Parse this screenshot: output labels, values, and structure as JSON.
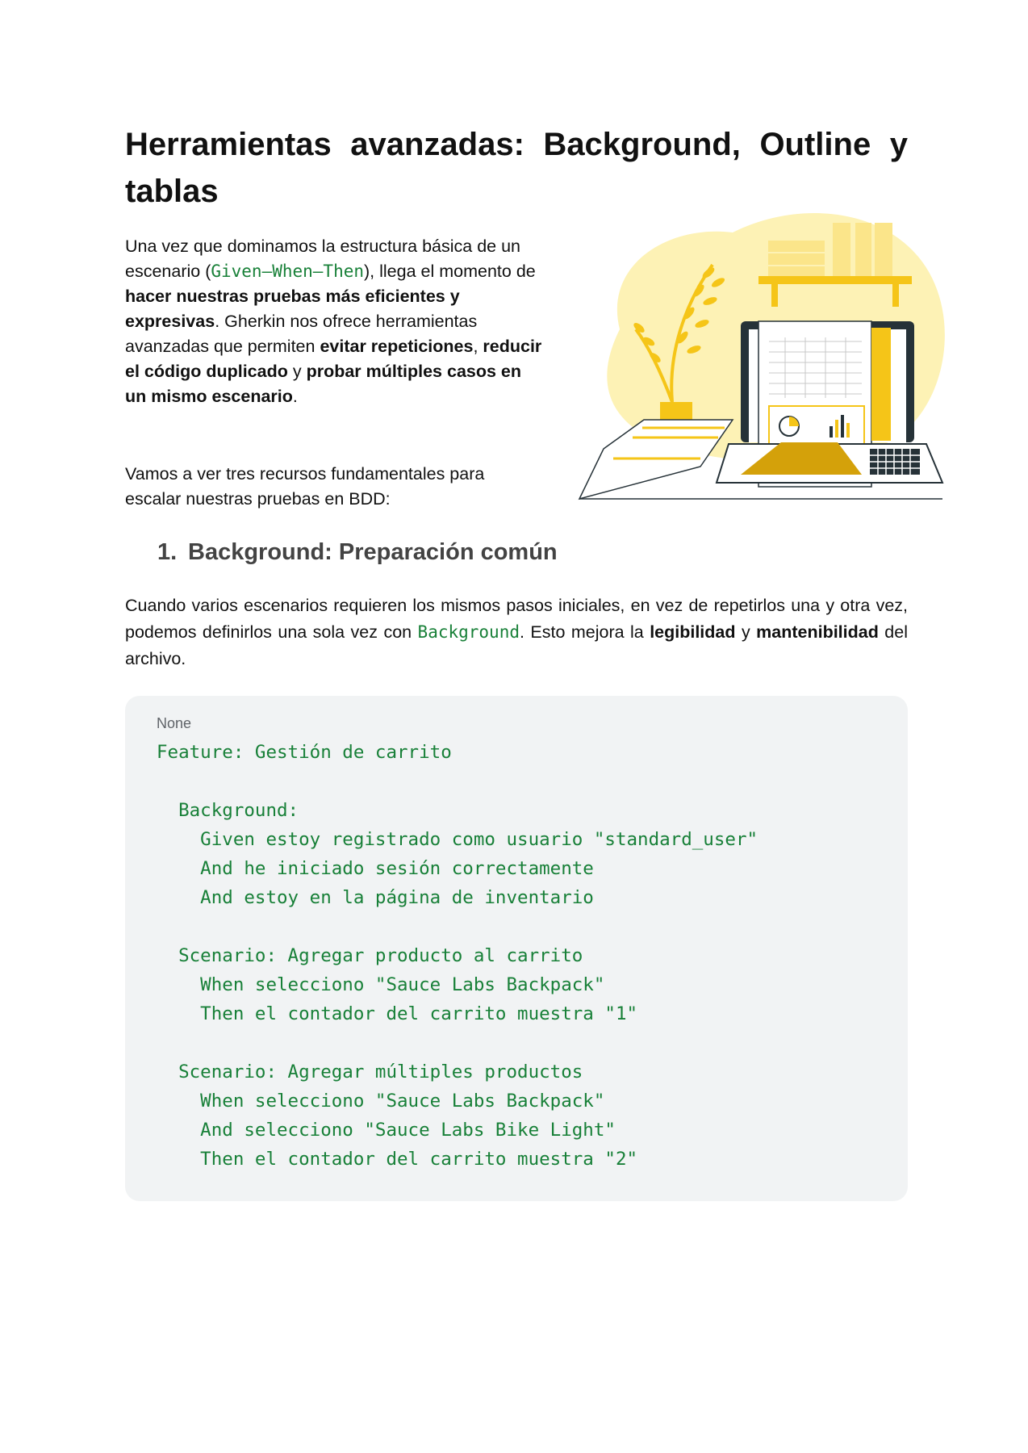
{
  "title": "Herramientas avanzadas: Background, Outline y tablas",
  "intro": {
    "t1": "Una vez que dominamos la estructura básica de un escenario (",
    "code1": "Given–When–Then",
    "t2": "), llega el momento de ",
    "b1": "hacer nuestras pruebas más eficientes y expresivas",
    "t3": ". Gherkin nos ofrece herramientas avanzadas que permiten ",
    "b2": "evitar repeticiones",
    "t4": ", ",
    "b3": "reducir el código duplicado",
    "t5": " y ",
    "b4": "probar múltiples casos en un mismo escenario",
    "t6": "."
  },
  "intro2": "Vamos a ver tres recursos fundamentales para escalar nuestras pruebas en BDD:",
  "section1": {
    "number": "1.",
    "heading": "Background: Preparación común",
    "p_t1": "Cuando varios escenarios requieren los mismos pasos iniciales, en vez de repetirlos una y otra vez, podemos definirlos una sola vez con ",
    "p_code": "Background",
    "p_t2": ". Esto mejora la ",
    "p_b1": "legibilidad",
    "p_t3": " y ",
    "p_b2": "mantenibilidad",
    "p_t4": " del archivo."
  },
  "code_block": {
    "language": "None",
    "code": "Feature: Gestión de carrito\n\n  Background:\n    Given estoy registrado como usuario \"standard_user\"\n    And he iniciado sesión correctamente\n    And estoy en la página de inventario\n\n  Scenario: Agregar producto al carrito\n    When selecciono \"Sauce Labs Backpack\"\n    Then el contador del carrito muestra \"1\"\n\n  Scenario: Agregar múltiples productos\n    When selecciono \"Sauce Labs Backpack\"\n    And selecciono \"Sauce Labs Bike Light\"\n    Then el contador del carrito muestra \"2\""
  },
  "colors": {
    "code_green": "#188038",
    "accent_yellow": "#f5c518",
    "light_yellow": "#fdf2b5",
    "dark_gray": "#263238"
  }
}
